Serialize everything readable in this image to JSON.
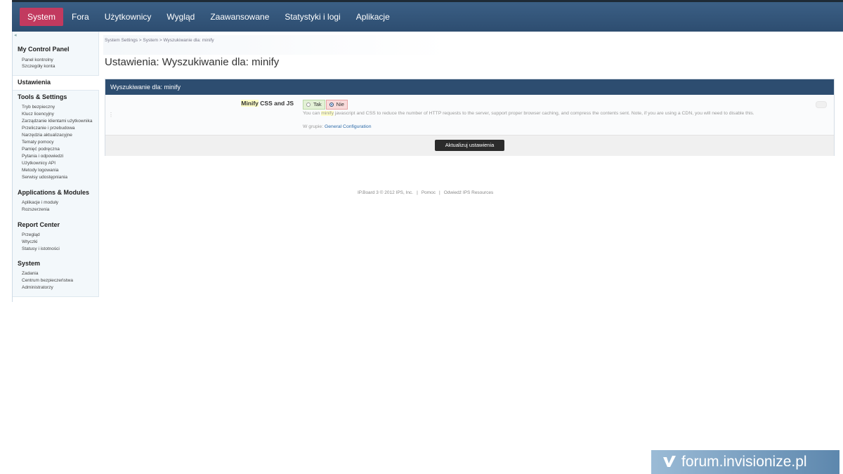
{
  "nav": {
    "items": [
      "System",
      "Fora",
      "Użytkownicy",
      "Wygląd",
      "Zaawansowane",
      "Statystyki i logi",
      "Aplikacje"
    ],
    "active_index": 0
  },
  "sidebar": {
    "sections": [
      {
        "title": "My Control Panel",
        "links": [
          "Panel kontrolny",
          "Szczegóły konta"
        ]
      },
      {
        "title": "Ustawienia",
        "links": []
      },
      {
        "title": "Tools & Settings",
        "links": [
          "Tryb bezpieczny",
          "Klucz licencyjny",
          "Zarządzanie klientami użytkownika",
          "Przeliczanie i przebudowa",
          "Narzędzia aktualizacyjne",
          "Tematy pomocy",
          "Pamięć podręczna",
          "Pytania i odpowiedzi",
          "Użytkownicy API",
          "Metody logowania",
          "Serwisy udostępniania"
        ]
      },
      {
        "title": "Applications & Modules",
        "links": [
          "Aplikacje i moduły",
          "Rozszerzenia"
        ]
      },
      {
        "title": "Report Center",
        "links": [
          "Przegląd",
          "Wtyczki",
          "Statusy i istotności"
        ]
      },
      {
        "title": "System",
        "links": [
          "Zadania",
          "Centrum bezpieczeństwa",
          "Administratorzy"
        ]
      }
    ]
  },
  "breadcrumb": "System Settings  >  System  >  Wyszukiwanie dla: minify",
  "page_title": "Ustawienia: Wyszukiwanie dla: minify",
  "panel": {
    "header": "Wyszukiwanie dla: minify",
    "setting": {
      "label_highlight": "Minify",
      "label_rest": " CSS and JS",
      "option_yes": "Tak",
      "option_no": "Nie",
      "selected": "Nie",
      "desc_pre": "You can ",
      "desc_hl": "minify",
      "desc_post": " javascript and CSS to reduce the number of HTTP requests to the server, support proper browser caching, and compress the contents sent. Note, if you are using a CDN, you will need to disable this.",
      "group_label": "W grupie: ",
      "group_link": "General Configuration"
    },
    "submit_label": "Aktualizuj ustawienia"
  },
  "footer": {
    "copyright": "IP.Board 3 © 2012 IPS, Inc.",
    "help": "Pomoc",
    "resources": "Odwiedź IPS Resources"
  },
  "watermark": "forum.invisionize.pl",
  "colors": {
    "nav_bg": "#2d4d70",
    "nav_active": "#c23a5f",
    "link": "#2c6aa8",
    "yes_bg": "#e3f1d6",
    "no_bg": "#f8dada"
  }
}
